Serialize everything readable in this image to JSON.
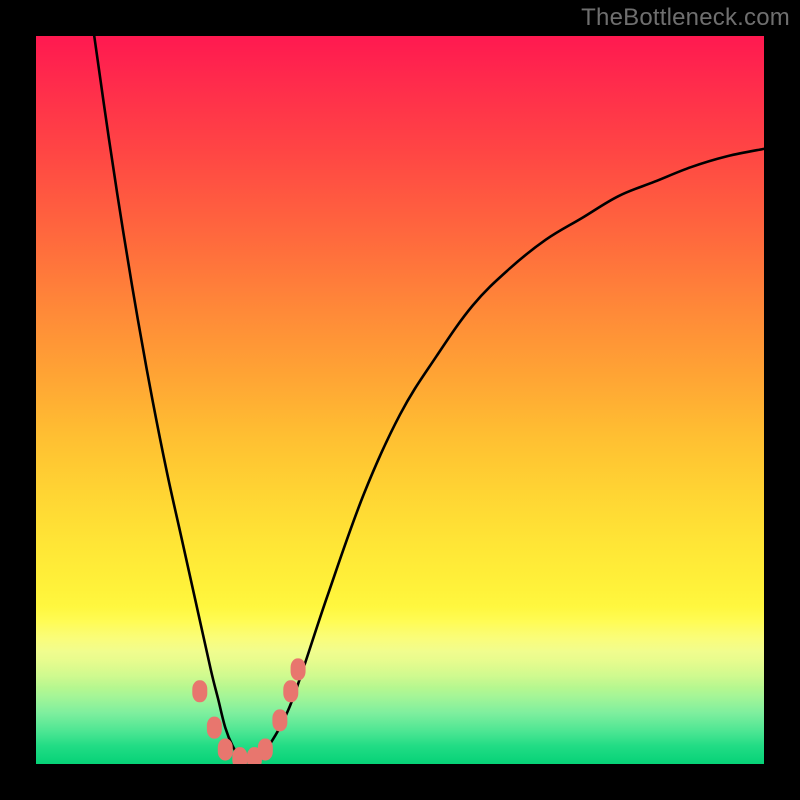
{
  "watermark": "TheBottleneck.com",
  "chart_data": {
    "type": "line",
    "title": "",
    "xlabel": "",
    "ylabel": "",
    "xlim": [
      0,
      100
    ],
    "ylim": [
      0,
      100
    ],
    "grid": false,
    "legend": false,
    "background": "rainbow-vertical",
    "gradient_stops": [
      {
        "pct": 0,
        "color": "#ff1950"
      },
      {
        "pct": 16,
        "color": "#ff4644"
      },
      {
        "pct": 38,
        "color": "#ff8a38"
      },
      {
        "pct": 55,
        "color": "#ffbf32"
      },
      {
        "pct": 76,
        "color": "#fff23a"
      },
      {
        "pct": 88,
        "color": "#c9f985"
      },
      {
        "pct": 97,
        "color": "#22dc85"
      },
      {
        "pct": 100,
        "color": "#06d277"
      }
    ],
    "series": [
      {
        "name": "bottleneck-curve",
        "color": "#000000",
        "x": [
          8,
          10,
          12,
          14,
          16,
          18,
          20,
          22,
          24,
          25,
          26,
          27,
          28,
          29,
          30,
          31,
          32,
          34,
          36,
          40,
          45,
          50,
          55,
          60,
          65,
          70,
          75,
          80,
          85,
          90,
          95,
          100
        ],
        "y": [
          100,
          86,
          73,
          61,
          50,
          40,
          31,
          22,
          13,
          9,
          5,
          2.5,
          1,
          0.4,
          0.4,
          1,
          2.5,
          6,
          11,
          23,
          37,
          48,
          56,
          63,
          68,
          72,
          75,
          78,
          80,
          82,
          83.5,
          84.5
        ]
      }
    ],
    "markers": [
      {
        "name": "data-dot",
        "shape": "rounded",
        "color": "#e8766e",
        "x": 22.5,
        "y": 10
      },
      {
        "name": "data-dot",
        "shape": "rounded",
        "color": "#e8766e",
        "x": 24.5,
        "y": 5
      },
      {
        "name": "data-dot",
        "shape": "rounded",
        "color": "#e8766e",
        "x": 26.0,
        "y": 2
      },
      {
        "name": "data-dot",
        "shape": "rounded",
        "color": "#e8766e",
        "x": 28.0,
        "y": 0.8
      },
      {
        "name": "data-dot",
        "shape": "rounded",
        "color": "#e8766e",
        "x": 30.0,
        "y": 0.8
      },
      {
        "name": "data-dot",
        "shape": "rounded",
        "color": "#e8766e",
        "x": 31.5,
        "y": 2
      },
      {
        "name": "data-dot",
        "shape": "rounded",
        "color": "#e8766e",
        "x": 33.5,
        "y": 6
      },
      {
        "name": "data-dot",
        "shape": "rounded",
        "color": "#e8766e",
        "x": 35.0,
        "y": 10
      },
      {
        "name": "data-dot",
        "shape": "rounded",
        "color": "#e8766e",
        "x": 36.0,
        "y": 13
      }
    ]
  }
}
